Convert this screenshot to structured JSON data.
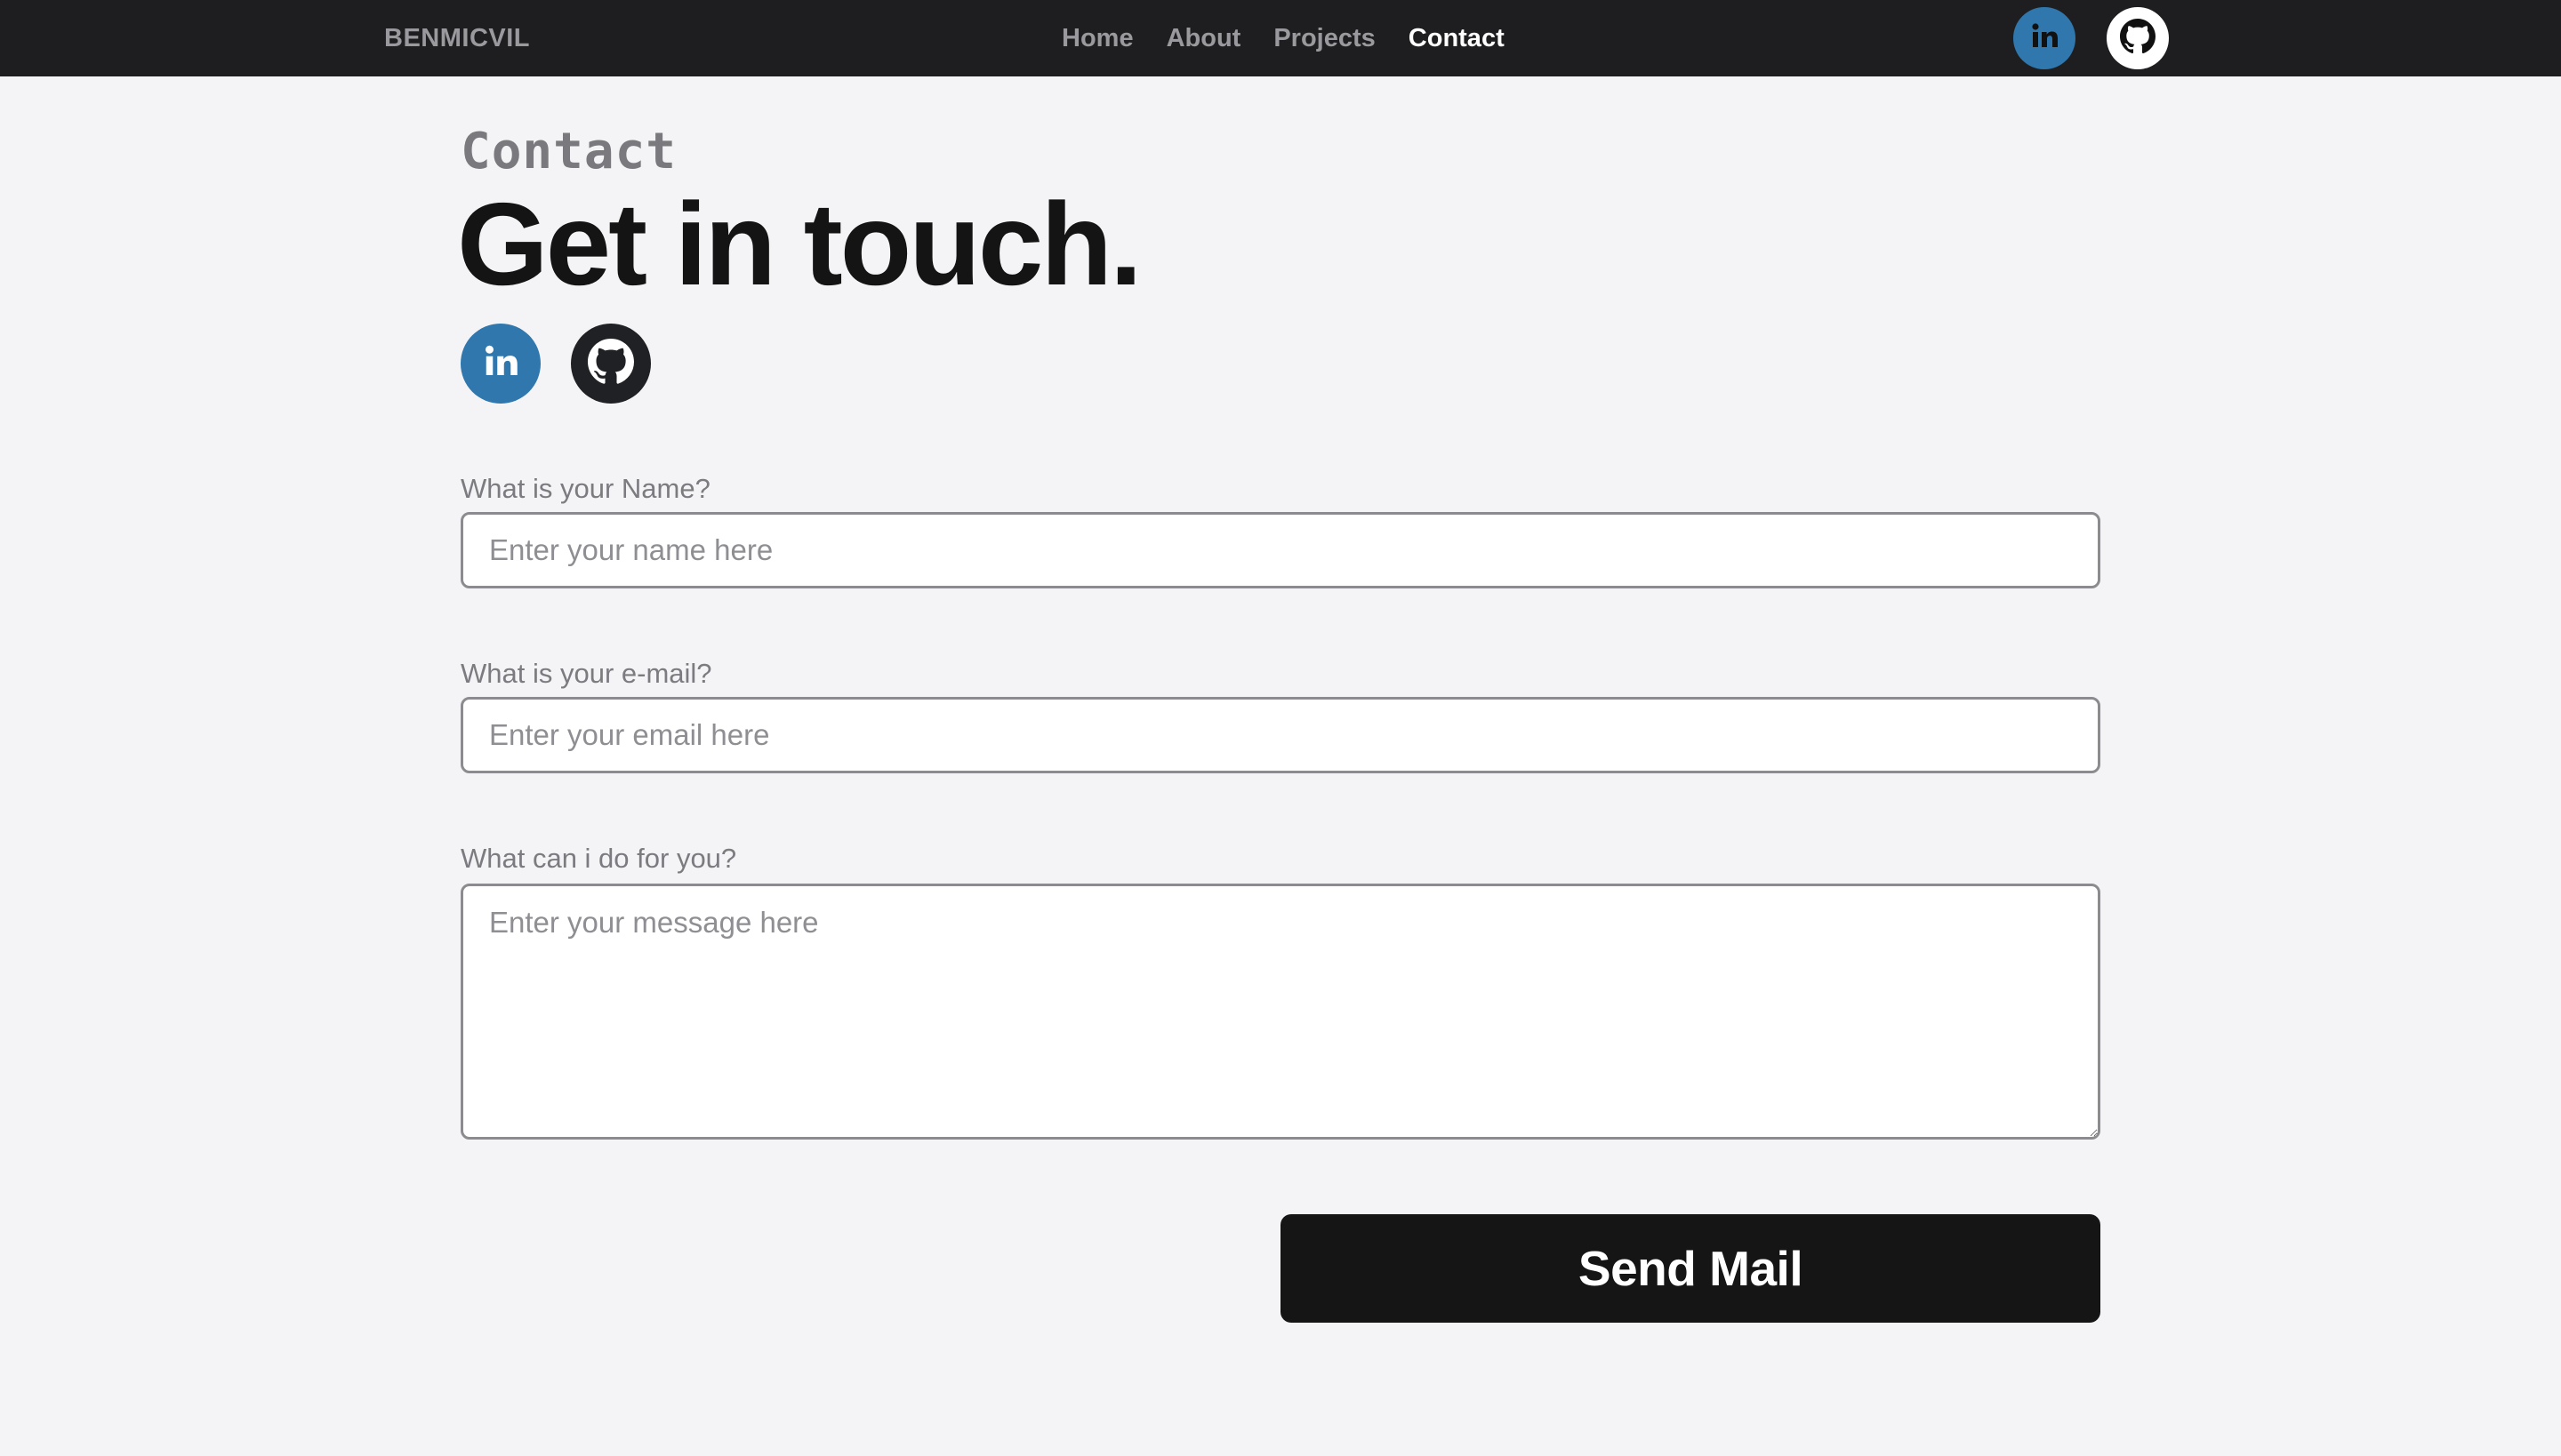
{
  "navbar": {
    "brand": "BENMICVIL",
    "links": [
      {
        "label": "Home",
        "active": false
      },
      {
        "label": "About",
        "active": false
      },
      {
        "label": "Projects",
        "active": false
      },
      {
        "label": "Contact",
        "active": true
      }
    ],
    "icons": [
      {
        "name": "linkedin-icon",
        "text": "in",
        "color": "#2f77ad"
      },
      {
        "name": "github-icon",
        "color": "#ffffff"
      }
    ]
  },
  "hero": {
    "section_label": "Contact",
    "headline": "Get in touch.",
    "social": [
      {
        "name": "linkedin-icon",
        "text": "in",
        "color": "#2f77ad"
      },
      {
        "name": "github-icon",
        "color": "#202124"
      }
    ]
  },
  "form": {
    "name": {
      "label": "What is your Name?",
      "placeholder": "Enter your name here",
      "value": ""
    },
    "email": {
      "label": "What is your e-mail?",
      "placeholder": "Enter your email here",
      "value": ""
    },
    "message": {
      "label": "What can i do for you?",
      "placeholder": "Enter your message here",
      "value": ""
    },
    "submit_label": "Send Mail"
  },
  "colors": {
    "navbar_bg": "#1e1e20",
    "page_bg": "#f4f4f6",
    "accent_linkedin": "#2f77ad",
    "button_bg": "#151515"
  }
}
